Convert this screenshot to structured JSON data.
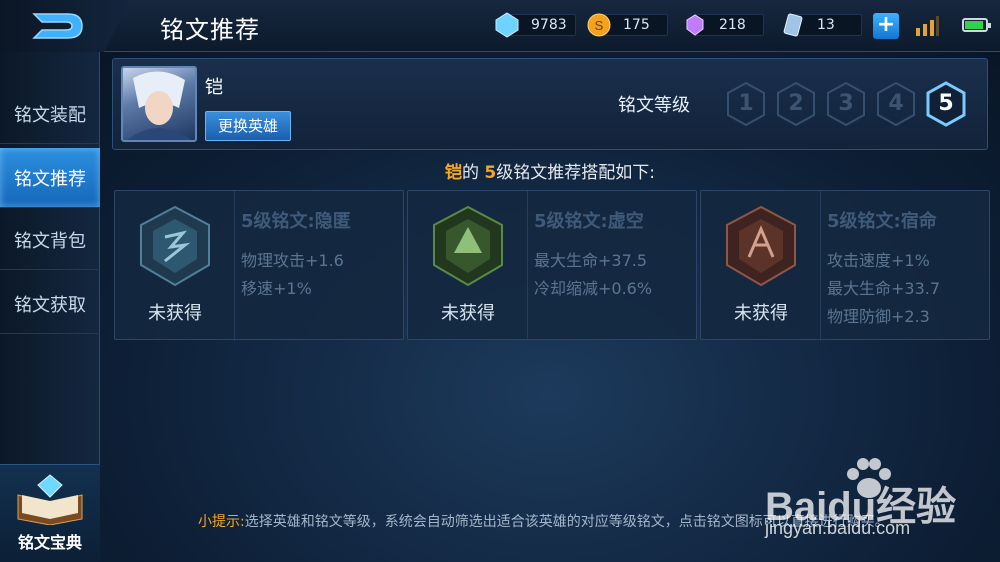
{
  "header": {
    "title": "铭文推荐",
    "currencies": [
      {
        "name": "diamond",
        "value": "9783"
      },
      {
        "name": "gold",
        "value": "175"
      },
      {
        "name": "gem",
        "value": "218"
      },
      {
        "name": "card",
        "value": "13"
      }
    ],
    "plus_label": "+"
  },
  "sidebar": {
    "items": [
      {
        "label": "铭文装配"
      },
      {
        "label": "铭文推荐"
      },
      {
        "label": "铭文背包"
      },
      {
        "label": "铭文获取"
      }
    ],
    "active_index": 1,
    "codex_label": "铭文宝典"
  },
  "hero": {
    "name": "铠",
    "change_button": "更换英雄",
    "level_label": "铭文等级",
    "levels": [
      "1",
      "2",
      "3",
      "4",
      "5"
    ],
    "selected_level": "5"
  },
  "recommend": {
    "hero": "铠",
    "prefix": "的 ",
    "level": "5",
    "suffix": "级铭文推荐搭配如下:"
  },
  "runes": [
    {
      "name": "5级铭文:隐匿",
      "status": "未获得",
      "stats": [
        "物理攻击+1.6",
        "移速+1%"
      ],
      "color": "#3d6e8a"
    },
    {
      "name": "5级铭文:虚空",
      "status": "未获得",
      "stats": [
        "最大生命+37.5",
        "冷却缩减+0.6%"
      ],
      "color": "#4f7a3e"
    },
    {
      "name": "5级铭文:宿命",
      "status": "未获得",
      "stats": [
        "攻击速度+1%",
        "最大生命+33.7",
        "物理防御+2.3"
      ],
      "color": "#8a4a3a"
    }
  ],
  "tip": {
    "label": "小提示:",
    "text": "选择英雄和铭文等级，系统会自动筛选出适合该英雄的对应等级铭文，点击铭文图标可以直接进行购买。"
  },
  "watermark": {
    "brand": "Baidu经验",
    "url": "jingyan.baidu.com"
  },
  "colors": {
    "accent": "#2d8fe0",
    "highlight": "#f5a623"
  }
}
